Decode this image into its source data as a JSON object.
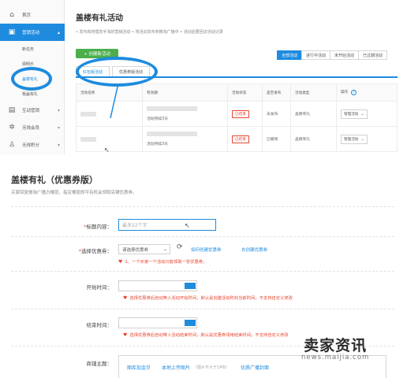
{
  "sidebar": {
    "items": [
      {
        "label": "首页",
        "icon": "home-icon"
      },
      {
        "label": "营销活动",
        "icon": "campaign-icon"
      },
      {
        "label": "互动营销",
        "icon": "interactive-icon"
      },
      {
        "label": "无线会员",
        "icon": "members-icon"
      },
      {
        "label": "无线积分",
        "icon": "points-icon"
      }
    ],
    "subitems": [
      "新任务",
      "猜明乐",
      "盖楼有礼",
      "我盖有礼"
    ]
  },
  "header": {
    "title": "盖楼有礼活动",
    "desc": "• 发布和管理您手淘的营销活动  • 将活动发布到微淘广播中  • 活动后要回访活动记录"
  },
  "actions": {
    "create_label": "+ 创建新活动"
  },
  "filters": [
    "全部活动",
    "进行中活动",
    "未开始活动",
    "已过期活动"
  ],
  "tabs": [
    "红包版活动",
    "优惠券版活动"
  ],
  "table": {
    "headers": [
      "活动名称",
      "有效期",
      "活动状态",
      "是否发布",
      "活动类型",
      "操作"
    ],
    "rows": [
      {
        "duration": "活动持续3天",
        "status": "已结束",
        "published": "未发布",
        "type": "盖楼有礼",
        "action": "管理活动"
      },
      {
        "duration": "活动持续3天",
        "status": "已结束",
        "published": "已撤销",
        "type": "盖楼有礼",
        "action": "管理活动"
      }
    ]
  },
  "form": {
    "title": "盖楼有礼（优惠券版）",
    "subtitle": "买家回复微淘广播占楼层，指定楼层即可有机会领取店铺优惠券。",
    "fields": {
      "title_label": "标题内容：",
      "title_placeholder": "最多22个字",
      "coupon_label": "选择优惠券：",
      "coupon_select": "请选择优惠券",
      "coupon_link_how": "如何创建优惠券",
      "coupon_link_go": "去创建优惠券",
      "coupon_tip": "1、一个买家一个活动只能领取一张优惠券。",
      "start_label": "开始时间：",
      "start_tip": "选择优惠券后自动带入活动开始时间，默认是创建活动时的当前时间，不支持自定义修改",
      "end_label": "结束时间：",
      "end_tip": "选择优惠券后自动带入活动结束时间，默认是优惠券领用结束时间，不支持自定义修改",
      "theme_label": "商铺主题：",
      "upload_options": [
        "图库加金贝",
        "本地上传图片",
        "（图片不大于1MB）",
        "优质广播封面"
      ]
    }
  },
  "watermark": {
    "cn": "卖家资讯",
    "url": "news.maijia.com"
  },
  "colors": {
    "accent": "#1e8bde",
    "success": "#4cae4c",
    "danger": "#e8452e"
  }
}
